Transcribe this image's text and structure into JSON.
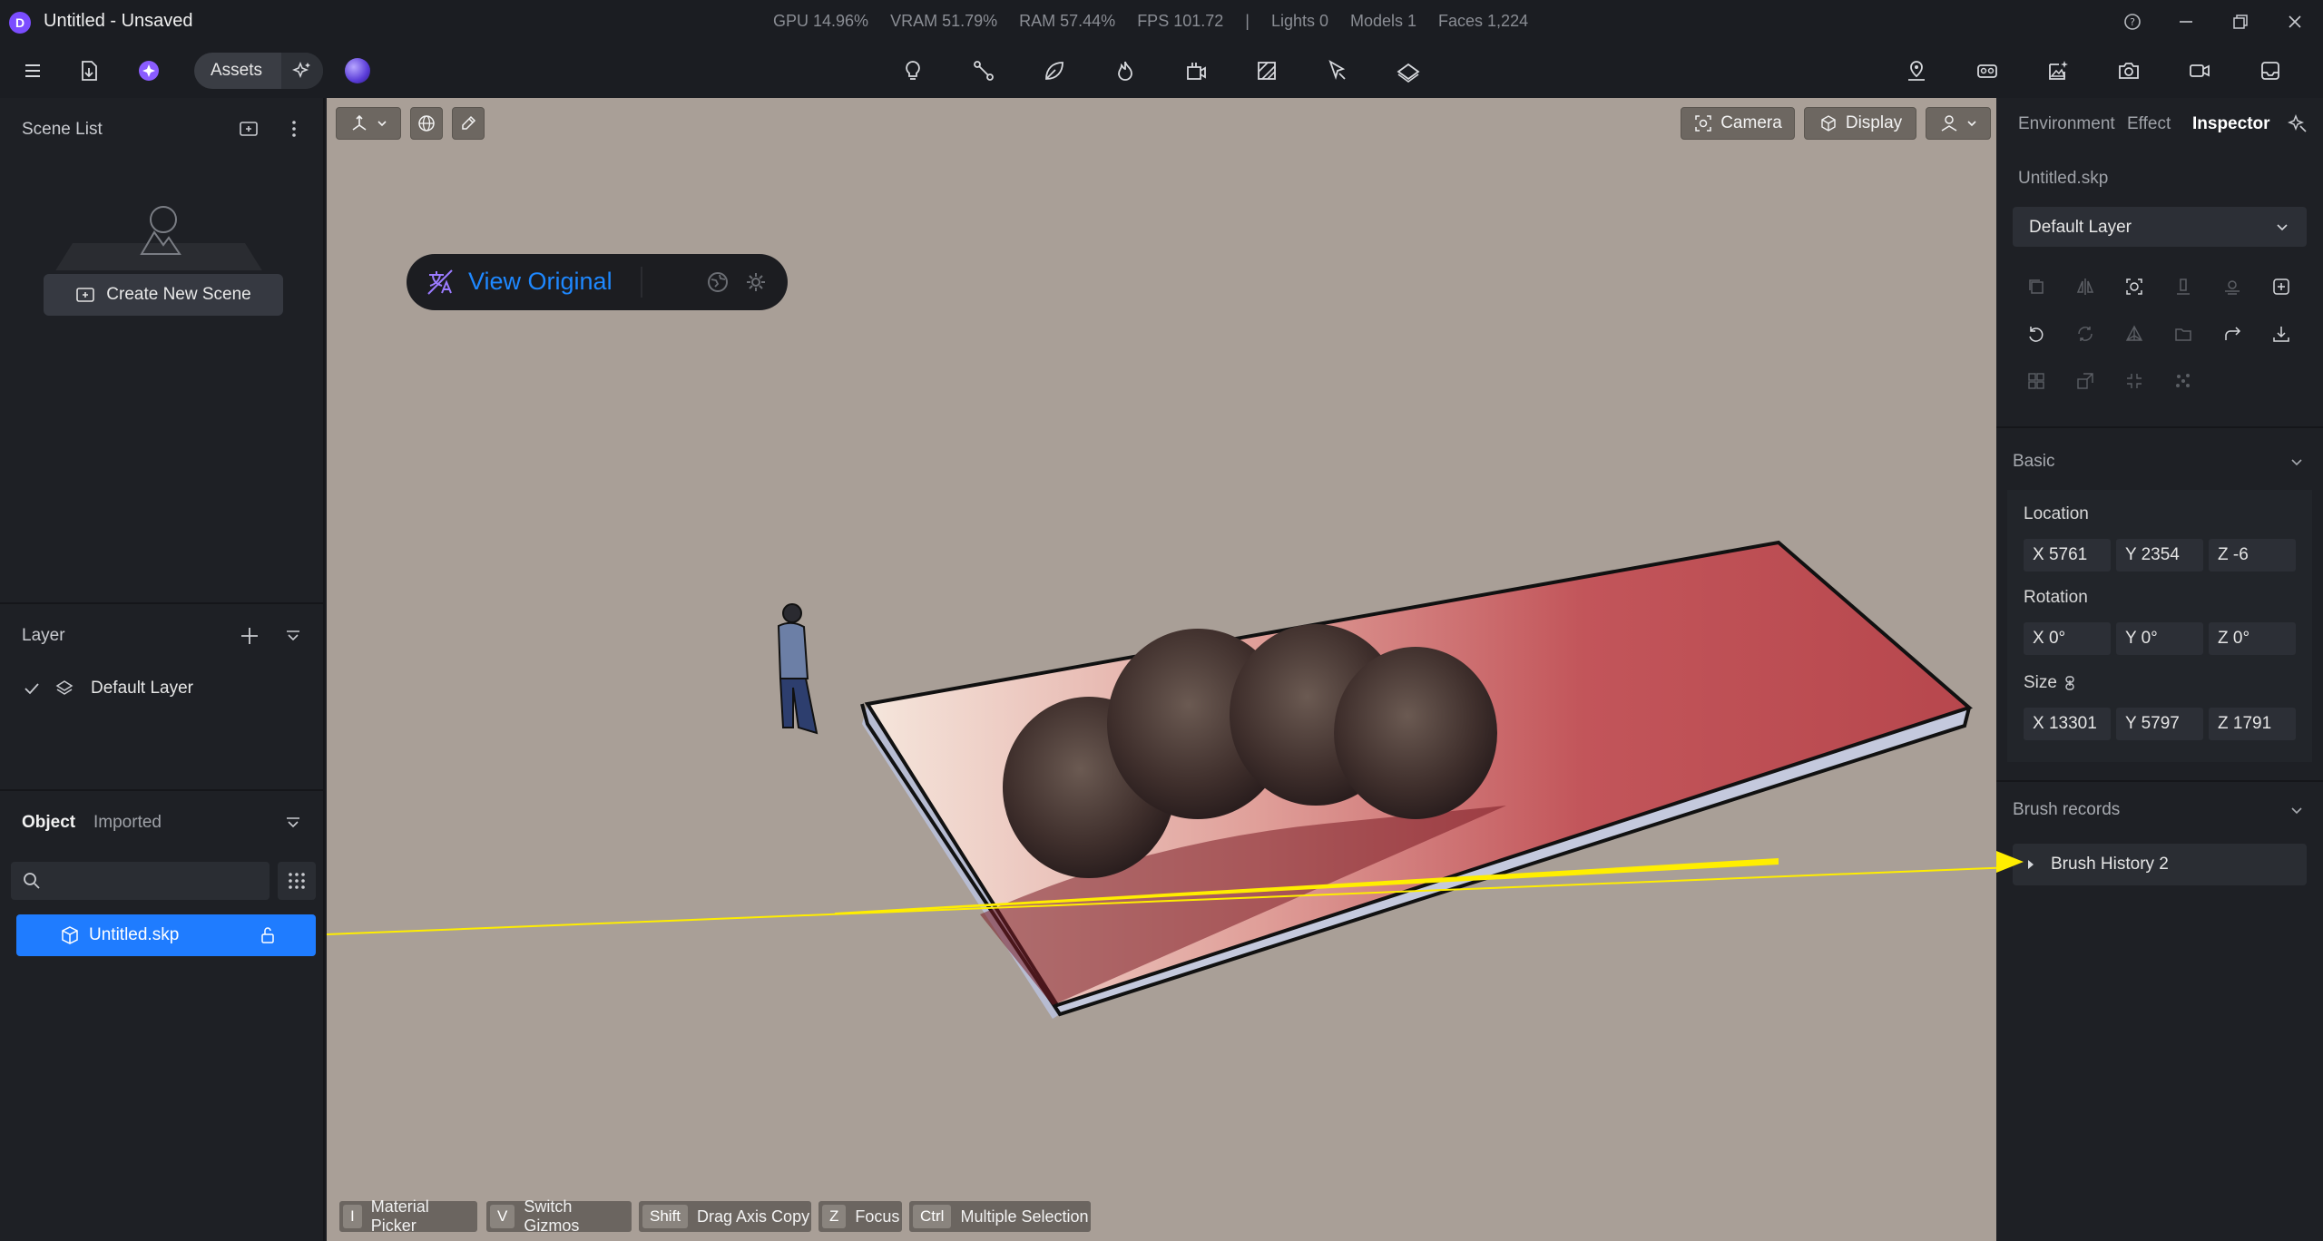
{
  "window": {
    "title": "Untitled - Unsaved",
    "logo_letter": "D",
    "stats": [
      "GPU 14.96%",
      "VRAM 51.79%",
      "RAM 57.44%",
      "FPS 101.72",
      "|",
      "Lights 0",
      "Models 1",
      "Faces 1,224"
    ]
  },
  "toolbar": {
    "assets_label": "Assets",
    "tool_icons": [
      "light-bulb-icon",
      "path-icon",
      "leaf-icon",
      "fire-icon",
      "object-icon",
      "material-icon",
      "select-cursor-icon",
      "layer-plane-icon"
    ],
    "right_icons": [
      "map-pin-icon",
      "vr-headset-icon",
      "image-edit-icon",
      "camera-icon",
      "video-icon",
      "inbox-icon"
    ]
  },
  "scene_list": {
    "title": "Scene List",
    "create_label": "Create New Scene"
  },
  "layer_panel": {
    "title": "Layer",
    "items": [
      {
        "label": "Default Layer",
        "checked": true
      }
    ]
  },
  "object_panel": {
    "tabs": [
      "Object",
      "Imported"
    ],
    "active_tab": "Object",
    "search_placeholder": "",
    "items": [
      {
        "label": "Untitled.skp",
        "selected": true
      }
    ]
  },
  "viewport": {
    "camera_label": "Camera",
    "display_label": "Display",
    "view_original_label": "View Original",
    "shortcuts": [
      {
        "key": "I",
        "label": "Material Picker"
      },
      {
        "key": "V",
        "label": "Switch Gizmos"
      },
      {
        "key": "Shift",
        "label": "Drag Axis Copy"
      },
      {
        "key": "Z",
        "label": "Focus"
      },
      {
        "key": "Ctrl",
        "label": "Multiple Selection"
      }
    ]
  },
  "inspector": {
    "tabs": [
      "Environment",
      "Effect",
      "Inspector"
    ],
    "active_tab": "Inspector",
    "file_name": "Untitled.skp",
    "layer_value": "Default Layer",
    "basic_title": "Basic",
    "location_label": "Location",
    "location": {
      "x": "X  5761",
      "y": "Y  2354",
      "z": "Z  -6"
    },
    "rotation_label": "Rotation",
    "rotation": {
      "x": "X  0°",
      "y": "Y  0°",
      "z": "Z  0°"
    },
    "size_label": "Size",
    "size": {
      "x": "X  13301",
      "y": "Y  5797",
      "z": "Z  1791"
    },
    "brush_title": "Brush records",
    "brush_items": [
      "Brush History 2"
    ]
  },
  "colors": {
    "accent_blue": "#1f7cff",
    "annotation_yellow": "#ffee00",
    "viewport_bg": "#a99f97"
  }
}
